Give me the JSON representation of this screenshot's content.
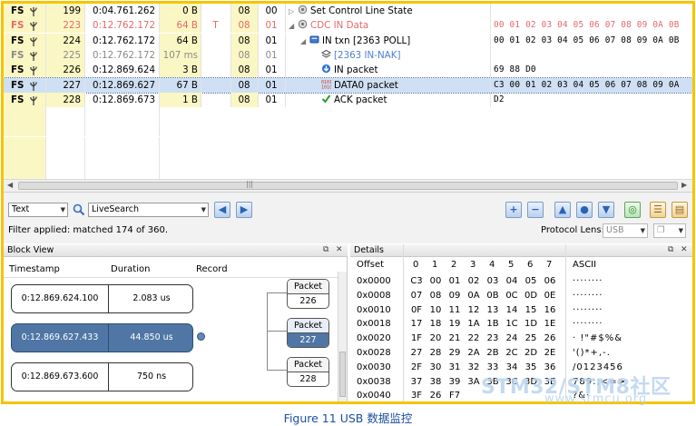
{
  "caption": "Figure 11 USB 数据监控",
  "watermark": {
    "line1": "STM32/STM8社区",
    "line2": "www.stmcu.org"
  },
  "trace_rows": [
    {
      "speed": "FS",
      "index": "199",
      "time": "0:04.761.262",
      "length": "0 B",
      "err": "",
      "dev": "08",
      "ep": "00",
      "record": "Set Control Line State",
      "indent": 0,
      "icon": "control-transfer-icon",
      "expander": "collapsed",
      "data": "",
      "style": "normal"
    },
    {
      "speed": "FS",
      "index": "223",
      "time": "0:12.762.172",
      "length": "64 B",
      "err": "T",
      "dev": "08",
      "ep": "01",
      "record": "CDC IN Data",
      "indent": 0,
      "icon": "control-transfer-icon",
      "expander": "expanded",
      "data": "00 01 02 03 04 05 06 07 08 09 0A 0B",
      "style": "red"
    },
    {
      "speed": "FS",
      "index": "224",
      "time": "0:12.762.172",
      "length": "64 B",
      "err": "",
      "dev": "08",
      "ep": "01",
      "record": "IN txn   [2363 POLL]",
      "indent": 1,
      "icon": "transaction-icon",
      "expander": "expanded",
      "data": "00 01 02 03 04 05 06 07 08 09 0A 0B",
      "style": "normal"
    },
    {
      "speed": "FS",
      "index": "225",
      "time": "0:12.762.172",
      "length": "107 ms",
      "err": "",
      "dev": "08",
      "ep": "01",
      "record": "[2363 IN-NAK]",
      "indent": 2,
      "icon": "stack-icon",
      "expander": "none",
      "data": "",
      "style": "gray"
    },
    {
      "speed": "FS",
      "index": "226",
      "time": "0:12.869.624",
      "length": "3 B",
      "err": "",
      "dev": "08",
      "ep": "01",
      "record": "IN packet",
      "indent": 2,
      "icon": "in-packet-icon",
      "expander": "none",
      "data": "69 88 D0",
      "style": "normal"
    },
    {
      "speed": "FS",
      "index": "227",
      "time": "0:12.869.627",
      "length": "67 B",
      "err": "",
      "dev": "08",
      "ep": "01",
      "record": "DATA0 packet",
      "indent": 2,
      "icon": "data-packet-icon",
      "expander": "none",
      "data": "C3 00 01 02 03 04 05 06 07 08 09 0A",
      "style": "selected"
    },
    {
      "speed": "FS",
      "index": "228",
      "time": "0:12.869.673",
      "length": "1 B",
      "err": "",
      "dev": "08",
      "ep": "01",
      "record": "ACK packet",
      "indent": 2,
      "icon": "ack-check-icon",
      "expander": "none",
      "data": "D2",
      "style": "normal"
    }
  ],
  "toolbar": {
    "view_select": "Text",
    "search_value": "LiveSearch",
    "filter_text": "Filter applied: matched 174 of 360.",
    "protocol_lens_label": "Protocol Lens:",
    "protocol_lens_value": "USB"
  },
  "block_view": {
    "title": "Block View",
    "col_timestamp": "Timestamp",
    "col_duration": "Duration",
    "col_record": "Record",
    "entries": [
      {
        "timestamp": "0:12.869.624.100",
        "duration": "2.083 us",
        "packet_label": "Packet",
        "packet_num": "226",
        "selected": false
      },
      {
        "timestamp": "0:12.869.627.433",
        "duration": "44.850 us",
        "packet_label": "Packet",
        "packet_num": "227",
        "selected": true
      },
      {
        "timestamp": "0:12.869.673.600",
        "duration": "750 ns",
        "packet_label": "Packet",
        "packet_num": "228",
        "selected": false
      }
    ]
  },
  "details": {
    "title": "Details",
    "col_offset": "Offset",
    "col_ascii": "ASCII",
    "byte_cols": [
      "0",
      "1",
      "2",
      "3",
      "4",
      "5",
      "6",
      "7"
    ],
    "rows": [
      {
        "offset": "0x0000",
        "bytes": [
          "C3",
          "00",
          "01",
          "02",
          "03",
          "04",
          "05",
          "06"
        ],
        "ascii": "········"
      },
      {
        "offset": "0x0008",
        "bytes": [
          "07",
          "08",
          "09",
          "0A",
          "0B",
          "0C",
          "0D",
          "0E"
        ],
        "ascii": "········"
      },
      {
        "offset": "0x0010",
        "bytes": [
          "0F",
          "10",
          "11",
          "12",
          "13",
          "14",
          "15",
          "16"
        ],
        "ascii": "········"
      },
      {
        "offset": "0x0018",
        "bytes": [
          "17",
          "18",
          "19",
          "1A",
          "1B",
          "1C",
          "1D",
          "1E"
        ],
        "ascii": "········"
      },
      {
        "offset": "0x0020",
        "bytes": [
          "1F",
          "20",
          "21",
          "22",
          "23",
          "24",
          "25",
          "26"
        ],
        "ascii": "· !\"#$%&"
      },
      {
        "offset": "0x0028",
        "bytes": [
          "27",
          "28",
          "29",
          "2A",
          "2B",
          "2C",
          "2D",
          "2E"
        ],
        "ascii": "'()*+,-."
      },
      {
        "offset": "0x0030",
        "bytes": [
          "2F",
          "30",
          "31",
          "32",
          "33",
          "34",
          "35",
          "36"
        ],
        "ascii": "/0123456"
      },
      {
        "offset": "0x0038",
        "bytes": [
          "37",
          "38",
          "39",
          "3A",
          "3B",
          "3C",
          "3D",
          "3E"
        ],
        "ascii": "789:;<=>"
      },
      {
        "offset": "0x0040",
        "bytes": [
          "3F",
          "26",
          "F7",
          "",
          "",
          "",
          "",
          ""
        ],
        "ascii": "?&·"
      }
    ]
  },
  "colors": {
    "border": "#f5c400",
    "selected_row": "#cfe0f4",
    "block_selected": "#4f76a4",
    "error_text": "#e26b6b",
    "caption": "#1c4fa0"
  }
}
